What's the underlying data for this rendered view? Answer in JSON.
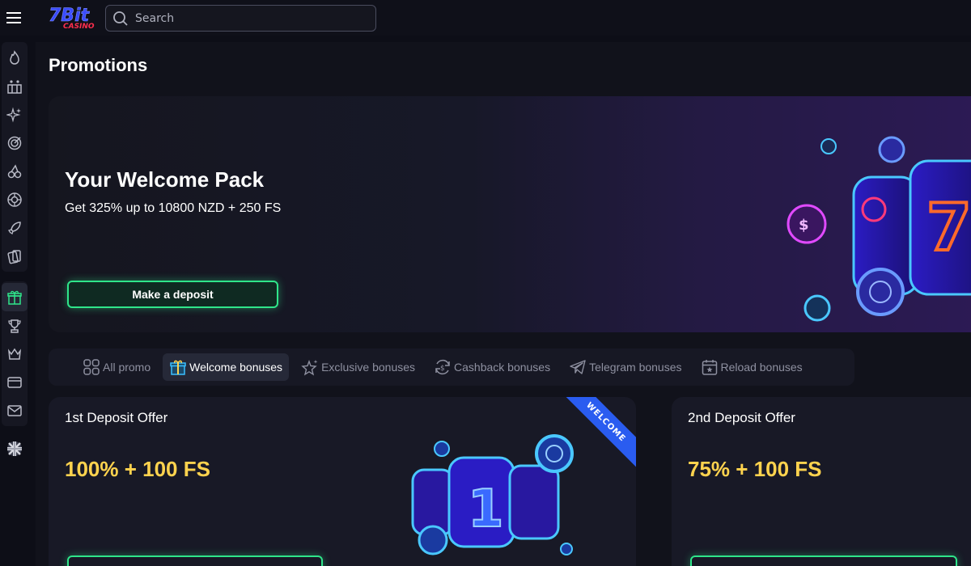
{
  "header": {
    "search_placeholder": "Search",
    "logo_text_top": "7Bit",
    "logo_text_bottom": "CASINO"
  },
  "sidebar": {
    "groups": [
      [
        "fire-icon",
        "slots-icon",
        "sparkles-icon",
        "target-icon",
        "cherry-icon",
        "roulette-icon",
        "rocket-icon",
        "cards-icon"
      ],
      [
        "gift-icon",
        "trophy-icon",
        "crown-icon",
        "card-payment-icon",
        "mail-icon"
      ]
    ],
    "active": "gift-icon",
    "language": "uk-flag-icon"
  },
  "page": {
    "title": "Promotions"
  },
  "banner": {
    "title": "Your Welcome Pack",
    "subtitle": "Get 325% up to 10800 NZD + 250 FS",
    "button_label": "Make a deposit"
  },
  "tabs": [
    {
      "label": "All promo",
      "icon": "grid-icon",
      "active": false
    },
    {
      "label": "Welcome bonuses",
      "icon": "gift-icon",
      "active": true
    },
    {
      "label": "Exclusive bonuses",
      "icon": "star-icon",
      "active": false
    },
    {
      "label": "Cashback bonuses",
      "icon": "cashback-icon",
      "active": false
    },
    {
      "label": "Telegram bonuses",
      "icon": "telegram-icon",
      "active": false
    },
    {
      "label": "Reload bonuses",
      "icon": "calendar-star-icon",
      "active": false
    }
  ],
  "cards": [
    {
      "title": "1st Deposit Offer",
      "value": "100% + 100 FS",
      "ribbon": "WELCOME"
    },
    {
      "title": "2nd Deposit Offer",
      "value": "75% + 100 FS"
    }
  ],
  "colors": {
    "accent_green": "#2fe58a",
    "value_yellow": "#ffd34e",
    "ribbon_blue": "#2a5cf0",
    "background": "#0d0e17"
  }
}
